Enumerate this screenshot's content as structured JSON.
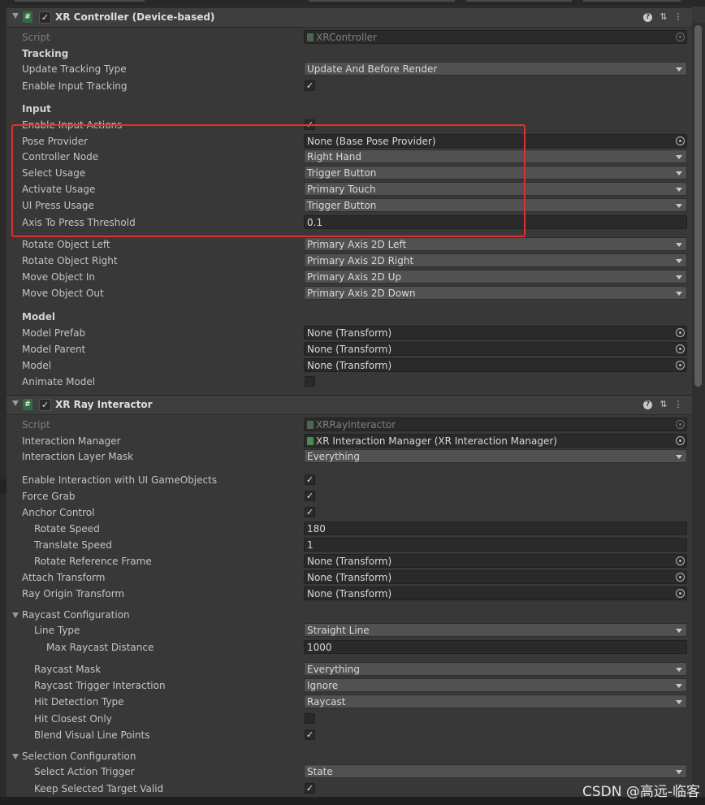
{
  "xr_controller": {
    "title": "XR Controller (Device-based)",
    "script_label": "Script",
    "script_value": "XRController",
    "tracking_header": "Tracking",
    "update_tracking_type_label": "Update Tracking Type",
    "update_tracking_type_value": "Update And Before Render",
    "enable_input_tracking_label": "Enable Input Tracking",
    "input_header": "Input",
    "enable_input_actions_label": "Enable Input Actions",
    "pose_provider_label": "Pose Provider",
    "pose_provider_value": "None (Base Pose Provider)",
    "controller_node_label": "Controller Node",
    "controller_node_value": "Right Hand",
    "select_usage_label": "Select Usage",
    "select_usage_value": "Trigger Button",
    "activate_usage_label": "Activate Usage",
    "activate_usage_value": "Primary Touch",
    "ui_press_usage_label": "UI Press Usage",
    "ui_press_usage_value": "Trigger Button",
    "axis_threshold_label": "Axis To Press Threshold",
    "axis_threshold_value": "0.1",
    "rotate_left_label": "Rotate Object Left",
    "rotate_left_value": "Primary Axis 2D Left",
    "rotate_right_label": "Rotate Object Right",
    "rotate_right_value": "Primary Axis 2D Right",
    "move_in_label": "Move Object In",
    "move_in_value": "Primary Axis 2D Up",
    "move_out_label": "Move Object Out",
    "move_out_value": "Primary Axis 2D Down",
    "model_header": "Model",
    "model_prefab_label": "Model Prefab",
    "model_prefab_value": "None (Transform)",
    "model_parent_label": "Model Parent",
    "model_parent_value": "None (Transform)",
    "model_label": "Model",
    "model_value": "None (Transform)",
    "animate_model_label": "Animate Model"
  },
  "xr_ray_interactor": {
    "title": "XR Ray Interactor",
    "script_label": "Script",
    "script_value": "XRRayInteractor",
    "interaction_manager_label": "Interaction Manager",
    "interaction_manager_value": "XR Interaction Manager (XR Interaction Manager)",
    "layer_mask_label": "Interaction Layer Mask",
    "layer_mask_value": "Everything",
    "enable_ui_label": "Enable Interaction with UI GameObjects",
    "force_grab_label": "Force Grab",
    "anchor_control_label": "Anchor Control",
    "rotate_speed_label": "Rotate Speed",
    "rotate_speed_value": "180",
    "translate_speed_label": "Translate Speed",
    "translate_speed_value": "1",
    "rotate_ref_label": "Rotate Reference Frame",
    "rotate_ref_value": "None (Transform)",
    "attach_transform_label": "Attach Transform",
    "attach_transform_value": "None (Transform)",
    "ray_origin_label": "Ray Origin Transform",
    "ray_origin_value": "None (Transform)",
    "raycast_config_label": "Raycast Configuration",
    "line_type_label": "Line Type",
    "line_type_value": "Straight Line",
    "max_distance_label": "Max Raycast Distance",
    "max_distance_value": "1000",
    "raycast_mask_label": "Raycast Mask",
    "raycast_mask_value": "Everything",
    "trigger_interaction_label": "Raycast Trigger Interaction",
    "trigger_interaction_value": "Ignore",
    "hit_detection_label": "Hit Detection Type",
    "hit_detection_value": "Raycast",
    "hit_closest_label": "Hit Closest Only",
    "blend_visual_label": "Blend Visual Line Points",
    "selection_config_label": "Selection Configuration",
    "select_action_label": "Select Action Trigger",
    "select_action_value": "State",
    "keep_selected_label": "Keep Selected Target Valid"
  },
  "icons": {
    "check": "✓",
    "script": "#",
    "help": "?",
    "preset": "⇅",
    "menu": "⋮"
  },
  "watermark": "CSDN @高远-临客"
}
